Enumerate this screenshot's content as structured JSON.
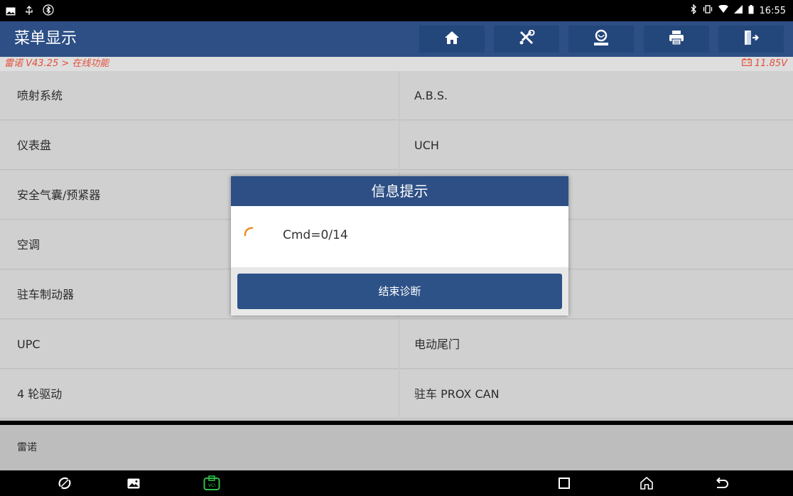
{
  "status_bar": {
    "time": "16:55"
  },
  "app": {
    "title": "菜单显示",
    "toolbar": [
      {
        "name": "home-icon"
      },
      {
        "name": "diagnose-tool-icon"
      },
      {
        "name": "user-icon"
      },
      {
        "name": "print-icon"
      },
      {
        "name": "exit-icon"
      }
    ]
  },
  "breadcrumb": {
    "path": "雷诺 V43.25 > 在线功能",
    "voltage": "11.85V"
  },
  "menu": {
    "left": [
      "喷射系统",
      "仪表盘",
      "安全气囊/预紧器",
      "空调",
      "驻车制动器",
      "UPC",
      "4 轮驱动"
    ],
    "right": [
      "A.B.S.",
      "UCH",
      "",
      "",
      "",
      "电动尾门",
      "驻车 PROX CAN"
    ]
  },
  "footer_label": "雷诺",
  "dialog": {
    "title": "信息提示",
    "message": "Cmd=0/14",
    "button": "结束诊断"
  },
  "colors": {
    "header": "#2d4f85",
    "accent": "#e04f3a",
    "spinner": "#f08a24"
  }
}
